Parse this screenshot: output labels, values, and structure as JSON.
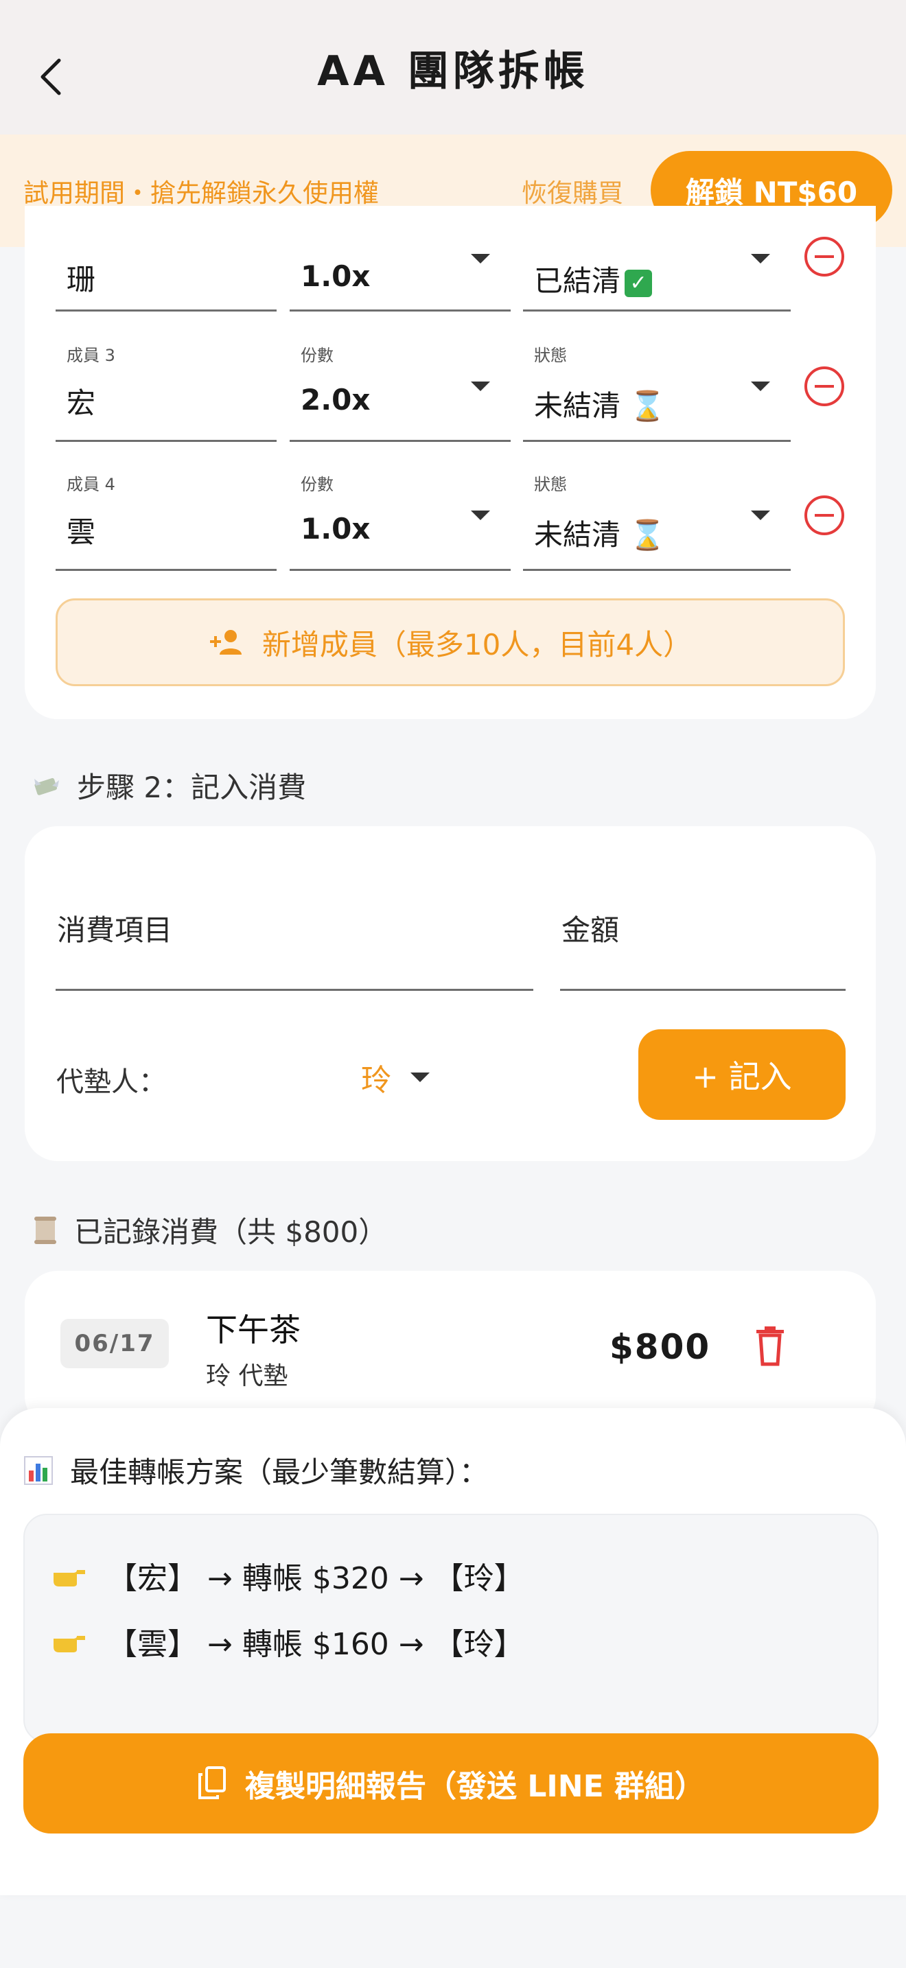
{
  "header": {
    "title": "AA 團隊拆帳"
  },
  "trial": {
    "message": "試用期間・搶先解鎖永久使用權",
    "restore_label": "恢復購買",
    "unlock_label": "解鎖 NT$60"
  },
  "members": [
    {
      "label": "",
      "name": "珊",
      "share_label": "",
      "share": "1.0x",
      "status_label": "",
      "status": "已結清",
      "settled": true
    },
    {
      "label": "成員 3",
      "name": "宏",
      "share_label": "份數",
      "share": "2.0x",
      "status_label": "狀態",
      "status": "未結清",
      "settled": false
    },
    {
      "label": "成員 4",
      "name": "雲",
      "share_label": "份數",
      "share": "1.0x",
      "status_label": "狀態",
      "status": "未結清",
      "settled": false
    }
  ],
  "add_member_label": "新增成員（最多10人，目前4人）",
  "step2": {
    "title": "步驟 2：記入消費",
    "item_placeholder": "消費項目",
    "amount_placeholder": "金額",
    "payer_label": "代墊人：",
    "payer_value": "玲",
    "record_label": "+ 記入"
  },
  "records": {
    "title": "已記錄消費（共 $800）",
    "items": [
      {
        "date": "06/17",
        "title": "下午茶",
        "payer": "玲 代墊",
        "amount": "$800"
      }
    ]
  },
  "settlement": {
    "title": "最佳轉帳方案（最少筆數結算）：",
    "transfers": [
      "【宏】 → 轉帳 $320 → 【玲】",
      "【雲】 → 轉帳 $160 → 【玲】"
    ],
    "copy_label": "複製明細報告（發送 LINE 群組）"
  },
  "colors": {
    "accent": "#f7990f",
    "danger": "#e53b3b",
    "settled": "#2a8a2a"
  }
}
